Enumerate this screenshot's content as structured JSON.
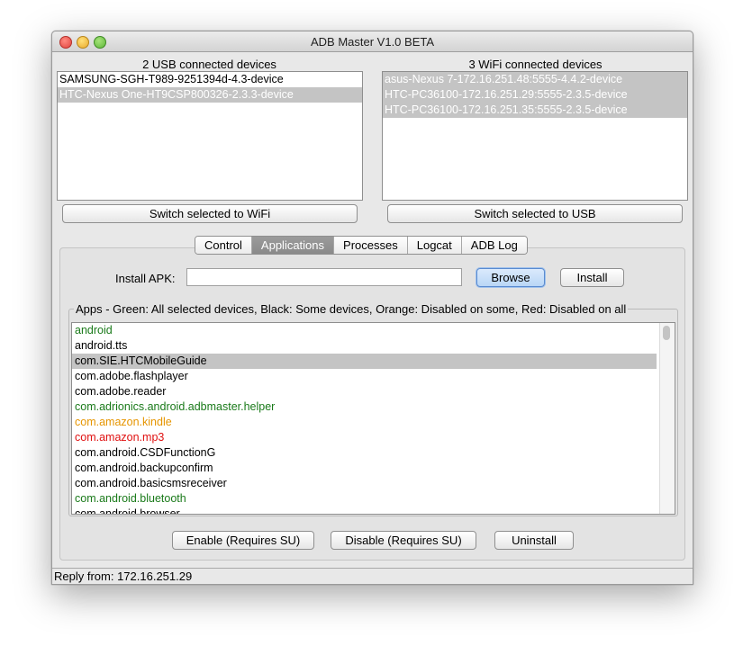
{
  "window": {
    "title": "ADB Master V1.0 BETA"
  },
  "usb": {
    "header": "2 USB connected devices",
    "devices": [
      {
        "label": "SAMSUNG-SGH-T989-9251394d-4.3-device",
        "selected": false
      },
      {
        "label": "HTC-Nexus One-HT9CSP800326-2.3.3-device",
        "selected": true
      }
    ],
    "switch_button": "Switch selected to WiFi"
  },
  "wifi": {
    "header": "3 WiFi connected devices",
    "devices": [
      {
        "label": "asus-Nexus 7-172.16.251.48:5555-4.4.2-device",
        "selected": true
      },
      {
        "label": "HTC-PC36100-172.16.251.29:5555-2.3.5-device",
        "selected": true
      },
      {
        "label": "HTC-PC36100-172.16.251.35:5555-2.3.5-device",
        "selected": true
      }
    ],
    "switch_button": "Switch selected to USB"
  },
  "tabs": [
    {
      "label": "Control",
      "active": false
    },
    {
      "label": "Applications",
      "active": true
    },
    {
      "label": "Processes",
      "active": false
    },
    {
      "label": "Logcat",
      "active": false
    },
    {
      "label": "ADB Log",
      "active": false
    }
  ],
  "install": {
    "label": "Install APK:",
    "value": "",
    "browse_button": "Browse",
    "install_button": "Install"
  },
  "apps": {
    "title": "Apps - Green: All selected devices, Black: Some devices, Orange: Disabled on some, Red: Disabled on all",
    "colors": {
      "green": "#1a7a1a",
      "black": "#000000",
      "orange": "#e69500",
      "red": "#e01010"
    },
    "items": [
      {
        "label": "android",
        "status": "green",
        "selected": false
      },
      {
        "label": "android.tts",
        "status": "black",
        "selected": false
      },
      {
        "label": "com.SIE.HTCMobileGuide",
        "status": "black",
        "selected": true
      },
      {
        "label": "com.adobe.flashplayer",
        "status": "black",
        "selected": false
      },
      {
        "label": "com.adobe.reader",
        "status": "black",
        "selected": false
      },
      {
        "label": "com.adrionics.android.adbmaster.helper",
        "status": "green",
        "selected": false
      },
      {
        "label": "com.amazon.kindle",
        "status": "orange",
        "selected": false
      },
      {
        "label": "com.amazon.mp3",
        "status": "red",
        "selected": false
      },
      {
        "label": "com.android.CSDFunctionG",
        "status": "black",
        "selected": false
      },
      {
        "label": "com.android.backupconfirm",
        "status": "black",
        "selected": false
      },
      {
        "label": "com.android.basicsmsreceiver",
        "status": "black",
        "selected": false
      },
      {
        "label": "com.android.bluetooth",
        "status": "green",
        "selected": false
      },
      {
        "label": "com.android.browser",
        "status": "black",
        "selected": false
      }
    ]
  },
  "actions": {
    "enable_button": "Enable (Requires SU)",
    "disable_button": "Disable (Requires SU)",
    "uninstall_button": "Uninstall"
  },
  "status_bar": {
    "text": "Reply from: 172.16.251.29"
  }
}
